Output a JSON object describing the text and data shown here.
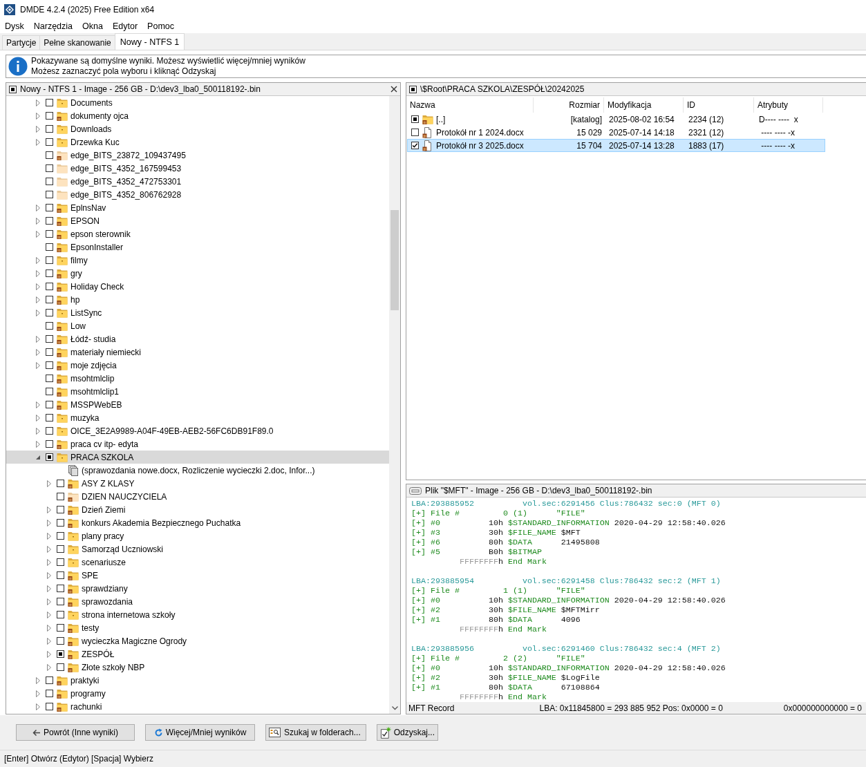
{
  "window": {
    "title": "DMDE 4.2.4 (2025) Free Edition x64"
  },
  "menu": [
    "Dysk",
    "Narzędzia",
    "Okna",
    "Edytor",
    "Pomoc"
  ],
  "tabs": [
    {
      "label": "Partycje",
      "selected": false
    },
    {
      "label": "Pełne skanowanie",
      "selected": false
    },
    {
      "label": "Nowy - NTFS 1",
      "selected": true
    }
  ],
  "info": {
    "lines": [
      "Pokazywane są domyślne wyniki. Możesz wyświetlić więcej/mniej wyników",
      "Możesz zaznaczyć pola wyboru i kliknąć Odzyskaj"
    ]
  },
  "tree": {
    "title": "Nowy - NTFS 1 - Image - 256 GB - D:\\dev3_lba0_500118192-.bin",
    "items": [
      {
        "name": "Documents",
        "kind": "folder",
        "expanded": false,
        "checked": false,
        "partial": false,
        "selected": false
      },
      {
        "name": "dokumenty ojca",
        "kind": "folder-deleted",
        "expanded": false,
        "checked": false,
        "partial": false,
        "selected": false
      },
      {
        "name": "Downloads",
        "kind": "folder",
        "expanded": false,
        "checked": false,
        "partial": false,
        "selected": false
      },
      {
        "name": "Drzewka Kuc",
        "kind": "folder",
        "expanded": false,
        "checked": false,
        "partial": false,
        "selected": false
      },
      {
        "name": "edge_BITS_23872_109437495",
        "kind": "folder-empty-deleted",
        "checked": false,
        "partial": false,
        "selected": false
      },
      {
        "name": "edge_BITS_4352_167599453",
        "kind": "folder-empty",
        "checked": false,
        "partial": false,
        "selected": false
      },
      {
        "name": "edge_BITS_4352_472753301",
        "kind": "folder-empty",
        "checked": false,
        "partial": false,
        "selected": false
      },
      {
        "name": "edge_BITS_4352_806762928",
        "kind": "folder-empty",
        "checked": false,
        "partial": false,
        "selected": false
      },
      {
        "name": "EplnsNav",
        "kind": "folder-deleted",
        "expanded": false,
        "checked": false,
        "partial": false,
        "selected": false
      },
      {
        "name": "EPSON",
        "kind": "folder-deleted",
        "expanded": false,
        "checked": false,
        "partial": false,
        "selected": false
      },
      {
        "name": "epson sterownik",
        "kind": "folder-deleted",
        "expanded": false,
        "checked": false,
        "partial": false,
        "selected": false
      },
      {
        "name": "EpsonInstaller",
        "kind": "folder-deleted",
        "checked": false,
        "partial": false,
        "selected": false
      },
      {
        "name": "filmy",
        "kind": "folder",
        "expanded": false,
        "checked": false,
        "partial": false,
        "selected": false
      },
      {
        "name": "gry",
        "kind": "folder-deleted",
        "expanded": false,
        "checked": false,
        "partial": false,
        "selected": false
      },
      {
        "name": "Holiday Check",
        "kind": "folder-deleted",
        "expanded": false,
        "checked": false,
        "partial": false,
        "selected": false
      },
      {
        "name": "hp",
        "kind": "folder-deleted",
        "expanded": false,
        "checked": false,
        "partial": false,
        "selected": false
      },
      {
        "name": "ListSync",
        "kind": "folder",
        "expanded": false,
        "checked": false,
        "partial": false,
        "selected": false
      },
      {
        "name": "Low",
        "kind": "folder-deleted",
        "checked": false,
        "partial": false,
        "selected": false
      },
      {
        "name": "Łódź- studia",
        "kind": "folder-deleted",
        "expanded": false,
        "checked": false,
        "partial": false,
        "selected": false
      },
      {
        "name": "materiały niemiecki",
        "kind": "folder-deleted",
        "expanded": false,
        "checked": false,
        "partial": false,
        "selected": false
      },
      {
        "name": "moje zdjęcia",
        "kind": "folder-deleted",
        "expanded": false,
        "checked": false,
        "partial": false,
        "selected": false
      },
      {
        "name": "msohtmlclip",
        "kind": "folder-deleted",
        "checked": false,
        "partial": false,
        "selected": false
      },
      {
        "name": "msohtmlclip1",
        "kind": "folder-deleted",
        "checked": false,
        "partial": false,
        "selected": false
      },
      {
        "name": "MSSPWebEB",
        "kind": "folder-deleted",
        "expanded": false,
        "checked": false,
        "partial": false,
        "selected": false
      },
      {
        "name": "muzyka",
        "kind": "folder",
        "expanded": false,
        "checked": false,
        "partial": false,
        "selected": false
      },
      {
        "name": "OICE_3E2A9989-A04F-49EB-AEB2-56FC6DB91F89.0",
        "kind": "folder",
        "expanded": false,
        "checked": false,
        "partial": false,
        "selected": false
      },
      {
        "name": "praca cv itp- edyta",
        "kind": "folder-deleted",
        "expanded": false,
        "checked": false,
        "partial": false,
        "selected": false
      },
      {
        "name": "PRACA SZKOLA",
        "kind": "folder",
        "expanded": true,
        "checked": false,
        "partial": true,
        "selected": true,
        "children": [
          {
            "name": "(sprawozdania nowe.docx, Rozliczenie wycieczki 2.doc, Infor...)",
            "kind": "files",
            "selected": false
          },
          {
            "name": "ASY Z KLASY",
            "kind": "folder-deleted",
            "expanded": false,
            "checked": false,
            "partial": false,
            "selected": false
          },
          {
            "name": "DZIEN NAUCZYCIELA",
            "kind": "folder-empty-deleted",
            "checked": false,
            "partial": false,
            "selected": false
          },
          {
            "name": "Dzień Ziemi",
            "kind": "folder-deleted",
            "expanded": false,
            "checked": false,
            "partial": false,
            "selected": false
          },
          {
            "name": "konkurs Akademia Bezpiecznego Puchatka",
            "kind": "folder-deleted",
            "expanded": false,
            "checked": false,
            "partial": false,
            "selected": false
          },
          {
            "name": "plany pracy",
            "kind": "folder",
            "expanded": false,
            "checked": false,
            "partial": false,
            "selected": false
          },
          {
            "name": "Samorząd Uczniowski",
            "kind": "folder",
            "expanded": false,
            "checked": false,
            "partial": false,
            "selected": false
          },
          {
            "name": "scenariusze",
            "kind": "folder",
            "expanded": false,
            "checked": false,
            "partial": false,
            "selected": false
          },
          {
            "name": "SPE",
            "kind": "folder-deleted",
            "expanded": false,
            "checked": false,
            "partial": false,
            "selected": false
          },
          {
            "name": "sprawdziany",
            "kind": "folder-deleted",
            "expanded": false,
            "checked": false,
            "partial": false,
            "selected": false
          },
          {
            "name": "sprawozdania",
            "kind": "folder-deleted",
            "expanded": false,
            "checked": false,
            "partial": false,
            "selected": false
          },
          {
            "name": "strona internetowa szkoły",
            "kind": "folder",
            "expanded": false,
            "checked": false,
            "partial": false,
            "selected": false
          },
          {
            "name": "testy",
            "kind": "folder-deleted",
            "expanded": false,
            "checked": false,
            "partial": false,
            "selected": false
          },
          {
            "name": "wycieczka Magiczne Ogrody",
            "kind": "folder-deleted",
            "expanded": false,
            "checked": false,
            "partial": false,
            "selected": false
          },
          {
            "name": "ZESPÓŁ",
            "kind": "folder-deleted",
            "expanded": false,
            "checked": false,
            "partial": true,
            "selected": false
          },
          {
            "name": "Złote szkoły NBP",
            "kind": "folder-deleted",
            "expanded": false,
            "checked": false,
            "partial": false,
            "selected": false
          }
        ]
      },
      {
        "name": "praktyki",
        "kind": "folder-deleted",
        "expanded": false,
        "checked": false,
        "partial": false,
        "selected": false
      },
      {
        "name": "programy",
        "kind": "folder-deleted",
        "expanded": false,
        "checked": false,
        "partial": false,
        "selected": false
      },
      {
        "name": "rachunki",
        "kind": "folder-deleted",
        "expanded": false,
        "checked": false,
        "partial": false,
        "selected": false
      }
    ]
  },
  "files": {
    "path": "\\$Root\\PRACA SZKOLA\\ZESPÓŁ\\20242025",
    "columns": [
      "Nazwa",
      "Rozmiar",
      "Modyfikacja",
      "ID",
      "Atrybuty"
    ],
    "rows": [
      {
        "kind": "folder-deleted",
        "checked": false,
        "partial": true,
        "selected": false,
        "name": "[..]",
        "size": "[katalog]",
        "modified": "2025-08-02 16:54",
        "id": "2234 (12)",
        "attributes": "D---- ----  x"
      },
      {
        "kind": "file-deleted",
        "checked": false,
        "partial": false,
        "selected": false,
        "name": "Protokół nr 1 2024.docx",
        "size": "15 029",
        "modified": "2025-07-14 14:18",
        "id": "2321 (12)",
        "attributes": " ---- ---- -x"
      },
      {
        "kind": "file-deleted",
        "checked": true,
        "partial": false,
        "selected": true,
        "name": "Protokół nr 3 2025.docx",
        "size": "15 704",
        "modified": "2025-07-14 13:28",
        "id": "1883 (17)",
        "attributes": " ---- ---- -x"
      }
    ]
  },
  "record": {
    "title": "Plik \"$MFT\" - Image - 256 GB - D:\\dev3_lba0_500118192-.bin",
    "blocks": [
      [
        [
          {
            "kind": "addr",
            "text": "LBA:293885952          vol.sec:6291456 Clus:786432 sec:0 (MFT 0)"
          }
        ],
        [
          {
            "kind": "tag",
            "text": "[+] File #         0 (1)      \"FILE\""
          }
        ],
        [
          {
            "kind": "tag",
            "text": "[+] #0          "
          },
          {
            "kind": "val",
            "text": "10h "
          },
          {
            "kind": "tag",
            "text": "$STANDARD_INFORMATION"
          },
          {
            "kind": "val",
            "text": " 2020-04-29 12:58:40.026"
          }
        ],
        [
          {
            "kind": "tag",
            "text": "[+] #3          "
          },
          {
            "kind": "val",
            "text": "30h "
          },
          {
            "kind": "tag",
            "text": "$FILE_NAME"
          },
          {
            "kind": "val",
            "text": " $MFT"
          }
        ],
        [
          {
            "kind": "tag",
            "text": "[+] #6          "
          },
          {
            "kind": "val",
            "text": "80h "
          },
          {
            "kind": "tag",
            "text": "$DATA"
          },
          {
            "kind": "val",
            "text": "      21495808"
          }
        ],
        [
          {
            "kind": "tag",
            "text": "[+] #5          "
          },
          {
            "kind": "val",
            "text": "B0h "
          },
          {
            "kind": "tag",
            "text": "$BITMAP"
          }
        ],
        [
          {
            "kind": "fill",
            "text": "          FFFFFFFF"
          },
          {
            "kind": "val",
            "text": "h "
          },
          {
            "kind": "tag",
            "text": "End Mark"
          }
        ]
      ],
      [
        [
          {
            "kind": "addr",
            "text": "LBA:293885954          vol.sec:6291458 Clus:786432 sec:2 (MFT 1)"
          }
        ],
        [
          {
            "kind": "tag",
            "text": "[+] File #         1 (1)      \"FILE\""
          }
        ],
        [
          {
            "kind": "tag",
            "text": "[+] #0          "
          },
          {
            "kind": "val",
            "text": "10h "
          },
          {
            "kind": "tag",
            "text": "$STANDARD_INFORMATION"
          },
          {
            "kind": "val",
            "text": " 2020-04-29 12:58:40.026"
          }
        ],
        [
          {
            "kind": "tag",
            "text": "[+] #2          "
          },
          {
            "kind": "val",
            "text": "30h "
          },
          {
            "kind": "tag",
            "text": "$FILE_NAME"
          },
          {
            "kind": "val",
            "text": " $MFTMirr"
          }
        ],
        [
          {
            "kind": "tag",
            "text": "[+] #1          "
          },
          {
            "kind": "val",
            "text": "80h "
          },
          {
            "kind": "tag",
            "text": "$DATA"
          },
          {
            "kind": "val",
            "text": "      4096"
          }
        ],
        [
          {
            "kind": "fill",
            "text": "          FFFFFFFF"
          },
          {
            "kind": "val",
            "text": "h "
          },
          {
            "kind": "tag",
            "text": "End Mark"
          }
        ]
      ],
      [
        [
          {
            "kind": "addr",
            "text": "LBA:293885956          vol.sec:6291460 Clus:786432 sec:4 (MFT 2)"
          }
        ],
        [
          {
            "kind": "tag",
            "text": "[+] File #         2 (2)      \"FILE\""
          }
        ],
        [
          {
            "kind": "tag",
            "text": "[+] #0          "
          },
          {
            "kind": "val",
            "text": "10h "
          },
          {
            "kind": "tag",
            "text": "$STANDARD_INFORMATION"
          },
          {
            "kind": "val",
            "text": " 2020-04-29 12:58:40.026"
          }
        ],
        [
          {
            "kind": "tag",
            "text": "[+] #2          "
          },
          {
            "kind": "val",
            "text": "30h "
          },
          {
            "kind": "tag",
            "text": "$FILE_NAME"
          },
          {
            "kind": "val",
            "text": " $LogFile"
          }
        ],
        [
          {
            "kind": "tag",
            "text": "[+] #1          "
          },
          {
            "kind": "val",
            "text": "80h "
          },
          {
            "kind": "tag",
            "text": "$DATA"
          },
          {
            "kind": "val",
            "text": "      67108864"
          }
        ],
        [
          {
            "kind": "fill",
            "text": "          FFFFFFFF"
          },
          {
            "kind": "val",
            "text": "h "
          },
          {
            "kind": "tag",
            "text": "End Mark"
          }
        ]
      ]
    ],
    "status": [
      "MFT Record",
      "LBA: 0x11845800 = 293 885 952  Pos: 0x0000 = 0",
      "0x000000000000 = 0"
    ]
  },
  "buttons": [
    {
      "kind": "back",
      "label": "Powrót (Inne wyniki)"
    },
    {
      "kind": "refresh",
      "label": "Więcej/Mniej wyników"
    },
    {
      "kind": "search",
      "label": "Szukaj w folderach..."
    },
    {
      "kind": "recover",
      "label": "Odzyskaj..."
    }
  ],
  "status_bar": "[Enter] Otwórz (Edytor)  [Spacja] Wybierz"
}
